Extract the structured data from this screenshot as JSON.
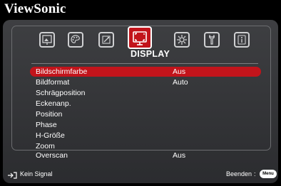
{
  "brand": {
    "name": "ViewSonic"
  },
  "tabs": [
    {
      "icon": "image-frame-icon"
    },
    {
      "icon": "color-palette-icon"
    },
    {
      "icon": "picture-settings-icon"
    },
    {
      "icon": "display-icon",
      "label": "DISPLAY",
      "active": true
    },
    {
      "icon": "gear-icon"
    },
    {
      "icon": "wrench-icon"
    },
    {
      "icon": "information-icon"
    }
  ],
  "menu": {
    "items": [
      {
        "label": "Bildschirmfarbe",
        "value": "Aus",
        "selected": true
      },
      {
        "label": "Bildformat",
        "value": "Auto"
      },
      {
        "label": "Schrägposition",
        "value": ""
      },
      {
        "label": "Eckenanp.",
        "value": ""
      },
      {
        "label": "Position",
        "value": ""
      },
      {
        "label": "Phase",
        "value": ""
      },
      {
        "label": "H-Größe",
        "value": ""
      },
      {
        "label": "Zoom",
        "value": ""
      },
      {
        "label": "Overscan",
        "value": "Aus"
      }
    ]
  },
  "footer": {
    "signal_icon": "input-source-icon",
    "signal_text": "Kein Signal",
    "exit_label": "Beenden",
    "exit_separator": ":",
    "menu_key": "Menu"
  },
  "colors": {
    "accent": "#c2141b",
    "panel": "#35363a"
  }
}
